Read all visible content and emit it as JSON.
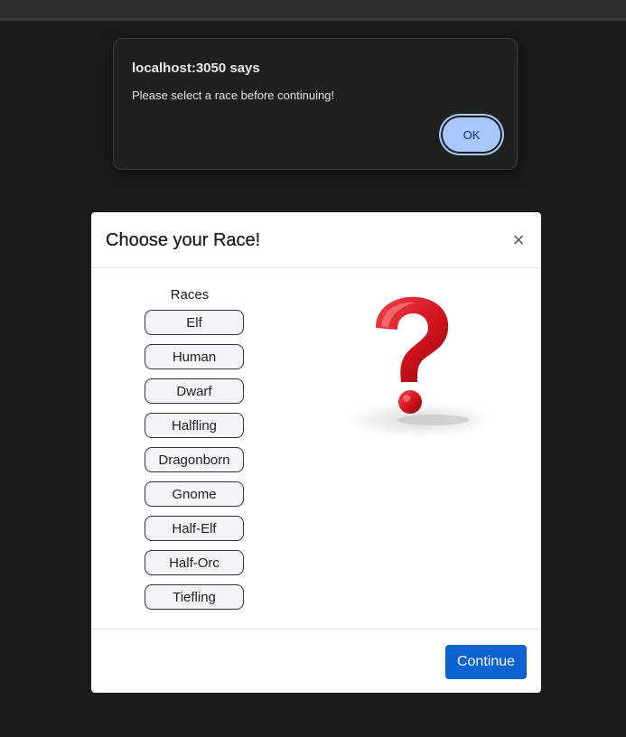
{
  "alert": {
    "title": "localhost:3050 says",
    "message": "Please select a race before continuing!",
    "ok_label": "OK",
    "accent_color": "#a8c7fa"
  },
  "modal": {
    "title": "Choose your Race!",
    "close_glyph": "×",
    "races_heading": "Races",
    "races": [
      "Elf",
      "Human",
      "Dwarf",
      "Halfling",
      "Dragonborn",
      "Gnome",
      "Half-Elf",
      "Half-Orc",
      "Tiefling"
    ],
    "image_icon": "question-mark-icon",
    "continue_label": "Continue",
    "primary_color": "#0b63d1"
  }
}
